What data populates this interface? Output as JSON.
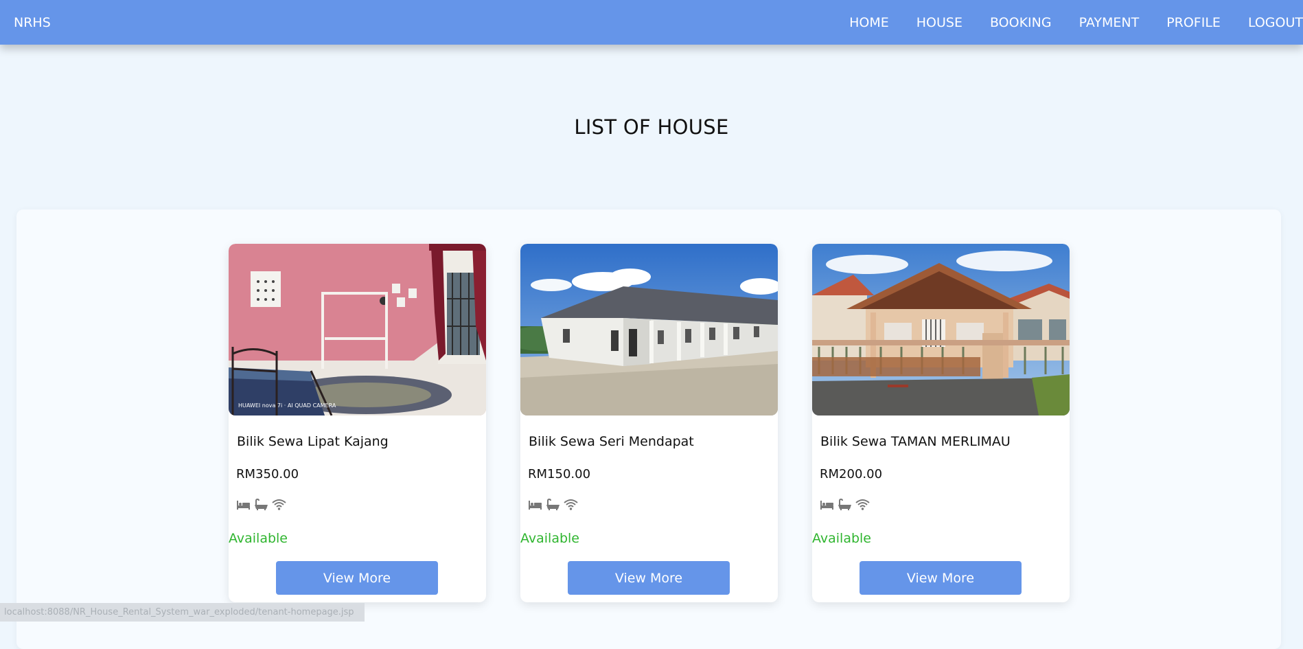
{
  "navbar": {
    "brand": "NRHS",
    "links": [
      "HOME",
      "HOUSE",
      "BOOKING",
      "PAYMENT",
      "PROFILE",
      "LOGOUT"
    ],
    "color": "#6595e9"
  },
  "page": {
    "title": "LIST OF HOUSE"
  },
  "houses": [
    {
      "title": "Bilik Sewa Lipat Kajang",
      "price": "RM350.00",
      "status": "Available",
      "button": "View More",
      "photo_watermark": "HUAWEI nova 7i · AI QUAD CAMERA"
    },
    {
      "title": "Bilik Sewa Seri Mendapat",
      "price": "RM150.00",
      "status": "Available",
      "button": "View More"
    },
    {
      "title": "Bilik Sewa TAMAN MERLIMAU",
      "price": "RM200.00",
      "status": "Available",
      "button": "View More"
    }
  ],
  "amenity_icons": [
    "bed-icon",
    "bathtub-icon",
    "wifi-icon"
  ],
  "status_color": "#2fb52f",
  "statusbar": {
    "url": "localhost:8088/NR_House_Rental_System_war_exploded/tenant-homepage.jsp"
  }
}
